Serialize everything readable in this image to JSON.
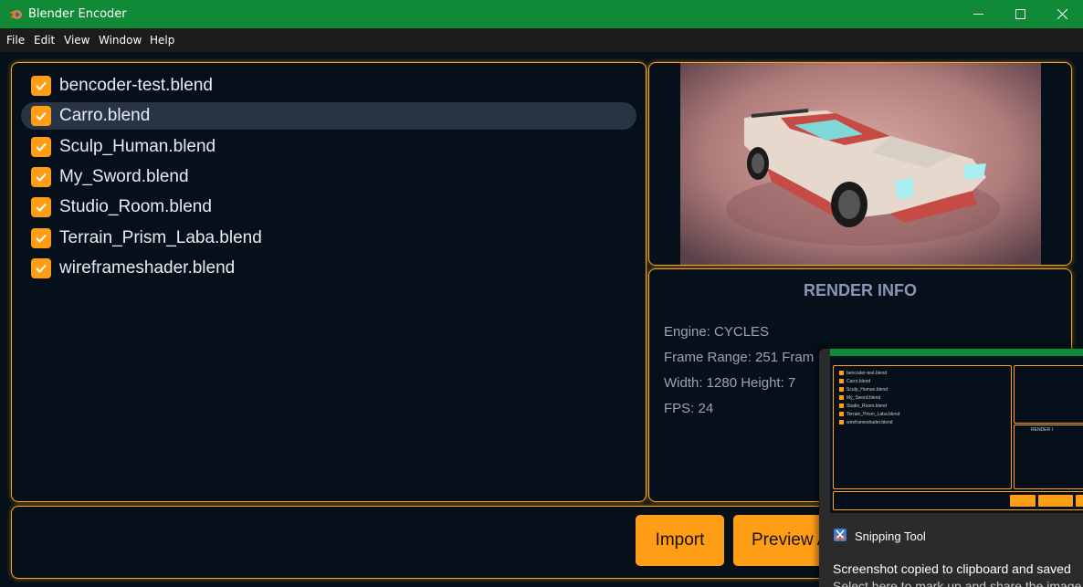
{
  "window": {
    "title": "Blender Encoder"
  },
  "menu": [
    "File",
    "Edit",
    "View",
    "Window",
    "Help"
  ],
  "files": [
    {
      "name": "bencoder-test.blend",
      "checked": true
    },
    {
      "name": "Carro.blend",
      "checked": true,
      "selected": true
    },
    {
      "name": "Sculp_Human.blend",
      "checked": true
    },
    {
      "name": "My_Sword.blend",
      "checked": true
    },
    {
      "name": "Studio_Room.blend",
      "checked": true
    },
    {
      "name": "Terrain_Prism_Laba.blend",
      "checked": true
    },
    {
      "name": "wireframeshader.blend",
      "checked": true
    }
  ],
  "render_info": {
    "title": "RENDER INFO",
    "engine": "Engine:  CYCLES",
    "frame_range": "Frame Range:  251  Fram",
    "size": "Width:  1280  Height:  7",
    "fps": "FPS:  24"
  },
  "buttons": {
    "import": "Import",
    "preview": "Preview A"
  },
  "notification": {
    "app": "Snipping Tool",
    "title": "Screenshot copied to clipboard and saved",
    "body": "Select here to mark up and share the image",
    "thumb_render_title": "RENDER I"
  },
  "colors": {
    "accent": "#ffa41b",
    "titlebar": "#118a38",
    "background": "#05101a"
  }
}
